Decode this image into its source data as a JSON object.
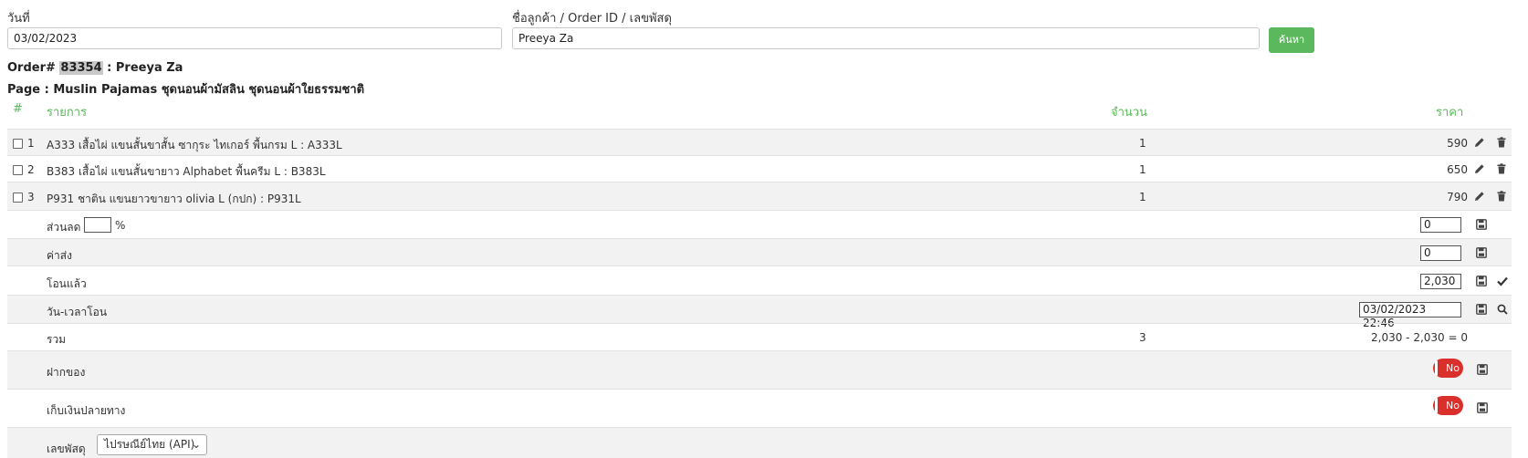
{
  "search": {
    "date_label": "วันที่",
    "date_value": "03/02/2023",
    "customer_label": "ชื่อลูกค้า / Order ID / เลขพัสดุ",
    "customer_value": "Preeya Za",
    "search_button": "ค้นหา"
  },
  "order": {
    "prefix": "Order#",
    "id": "83354",
    "customer": " : Preeya Za",
    "page_line": "Page : Muslin Pajamas ชุดนอนผ้ามัสลิน ชุดนอนผ้าใยธรรมชาติ"
  },
  "table": {
    "headers": {
      "num": "#",
      "item": "รายการ",
      "qty": "จำนวน",
      "price": "ราคา"
    },
    "rows": [
      {
        "num": "1",
        "item": "A333 เสื้อไผ่ แขนสั้นขาสั้น ซากุระ ไทเกอร์ พื้นกรม L : A333L",
        "qty": "1",
        "price": "590"
      },
      {
        "num": "2",
        "item": "B383 เสื้อไผ่ แขนสั้นขายาว Alphabet พื้นครีม L : B383L",
        "qty": "1",
        "price": "650"
      },
      {
        "num": "3",
        "item": "P931 ชาติน แขนยาวขายาว olivia L (กปก) : P931L",
        "qty": "1",
        "price": "790"
      }
    ]
  },
  "summary": {
    "discount_label": "ส่วนลด",
    "discount_percent_value": "",
    "percent_sign": "%",
    "discount_value": "0",
    "shipping_label": "ค่าส่ง",
    "shipping_value": "0",
    "paid_label": "โอนแล้ว",
    "paid_value": "2,030",
    "paid_datetime_label": "วัน-เวลาโอน",
    "paid_datetime_value": "03/02/2023 22:46",
    "total_label": "รวม",
    "total_qty": "3",
    "total_calc": "2,030 - 2,030 = 0",
    "deposit_label": "ฝากของ",
    "deposit_toggle": "No",
    "cod_label": "เก็บเงินปลายทาง",
    "cod_toggle": "No",
    "tracking_label": "เลขพัสดุ",
    "tracking_select": "ไปรษณีย์ไทย (API)"
  },
  "colors": {
    "accent_green": "#5cb85c",
    "toggle_red": "#d9302c",
    "row_shade": "#f2f2f2"
  },
  "icons": {
    "edit": "pencil-icon",
    "delete": "trash-icon",
    "save": "save-icon",
    "check": "check-icon",
    "search": "search-icon"
  }
}
